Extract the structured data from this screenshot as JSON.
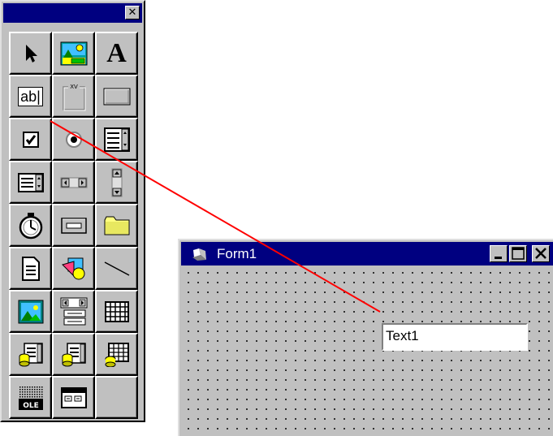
{
  "toolbox": {
    "close_glyph": "✕",
    "tools": [
      {
        "name": "pointer-tool",
        "icon": "pointer-icon"
      },
      {
        "name": "picturebox-tool",
        "icon": "picture-box-icon"
      },
      {
        "name": "label-tool",
        "icon": "label-icon",
        "text": "A"
      },
      {
        "name": "textbox-tool",
        "icon": "textbox-icon",
        "text": "ab|"
      },
      {
        "name": "frame-tool",
        "icon": "frame-icon",
        "text": "XV"
      },
      {
        "name": "commandbutton-tool",
        "icon": "command-button-icon"
      },
      {
        "name": "checkbox-tool",
        "icon": "checkbox-icon"
      },
      {
        "name": "optionbutton-tool",
        "icon": "option-button-icon"
      },
      {
        "name": "combobox-tool",
        "icon": "combo-box-icon"
      },
      {
        "name": "listbox-tool",
        "icon": "list-box-icon"
      },
      {
        "name": "hscrollbar-tool",
        "icon": "horizontal-scrollbar-icon"
      },
      {
        "name": "vscrollbar-tool",
        "icon": "vertical-scrollbar-icon"
      },
      {
        "name": "timer-tool",
        "icon": "timer-icon"
      },
      {
        "name": "drivelistbox-tool",
        "icon": "drive-list-icon"
      },
      {
        "name": "dirlistbox-tool",
        "icon": "folder-icon"
      },
      {
        "name": "filelistbox-tool",
        "icon": "file-list-icon"
      },
      {
        "name": "shape-tool",
        "icon": "shape-icon"
      },
      {
        "name": "line-tool",
        "icon": "line-icon"
      },
      {
        "name": "image-tool",
        "icon": "image-icon"
      },
      {
        "name": "data-tool",
        "icon": "data-control-icon"
      },
      {
        "name": "grid-tool",
        "icon": "grid-icon"
      },
      {
        "name": "dbcombo-tool",
        "icon": "db-combo-icon"
      },
      {
        "name": "dblist-tool",
        "icon": "db-list-icon"
      },
      {
        "name": "dbgrid-tool",
        "icon": "db-grid-icon"
      },
      {
        "name": "ole-tool",
        "icon": "ole-icon",
        "text": "OLE"
      },
      {
        "name": "tabstrip-tool",
        "icon": "tab-strip-icon"
      }
    ]
  },
  "form": {
    "title": "Form1",
    "textbox_value": "Text1",
    "minimize_icon": "minimize-icon",
    "maximize_icon": "maximize-icon",
    "close_icon": "close-icon"
  },
  "colors": {
    "titlebar": "#000080",
    "face": "#c0c0c0",
    "connector": "#ff0000"
  }
}
